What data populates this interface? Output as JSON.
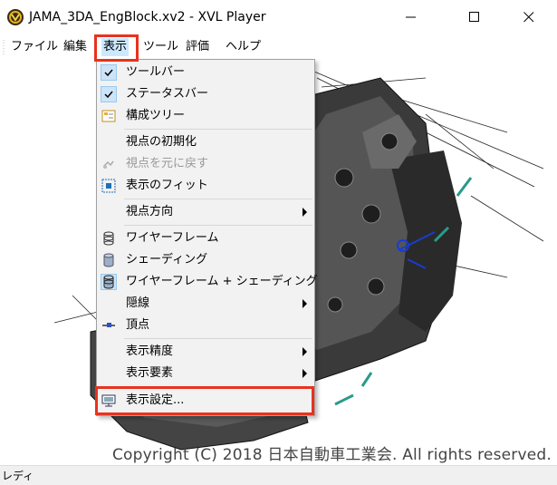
{
  "window": {
    "title": "JAMA_3DA_EngBlock.xv2 - XVL Player",
    "minimize_glyph": "—",
    "maximize_glyph": "☐",
    "close_glyph": "✕"
  },
  "menubar": {
    "items": [
      "ファイル",
      "編集",
      "表示",
      "ツール",
      "評価",
      "ヘルプ"
    ]
  },
  "dropdown": {
    "items": [
      {
        "label": "ツールバー",
        "checked": true
      },
      {
        "label": "ステータスバー",
        "checked": true
      },
      {
        "label": "構成ツリー",
        "icon": "tree-icon"
      },
      {
        "label": "視点の初期化"
      },
      {
        "label": "視点を元に戻す",
        "disabled": true,
        "icon": "undo-view-icon"
      },
      {
        "label": "表示のフィット",
        "icon": "fit-icon"
      },
      {
        "label": "視点方向",
        "submenu": true
      },
      {
        "label": "ワイヤーフレーム",
        "icon": "wireframe-icon"
      },
      {
        "label": "シェーディング",
        "icon": "shading-icon"
      },
      {
        "label": "ワイヤーフレーム + シェーディング",
        "icon": "wireframe-shading-icon"
      },
      {
        "label": "隠線",
        "submenu": true
      },
      {
        "label": "頂点",
        "icon": "vertex-icon"
      },
      {
        "label": "表示精度",
        "submenu": true
      },
      {
        "label": "表示要素",
        "submenu": true
      },
      {
        "label": "表示設定...",
        "icon": "display-settings-icon"
      }
    ]
  },
  "canvas": {
    "copyright": "Copyright (C) 2018 日本自動車工業会. All rights reserved."
  },
  "status": {
    "text": "レディ"
  },
  "colors": {
    "highlight": "#e8321e",
    "menu_bg": "#f2f2f2",
    "accent": "#1f6fb5"
  }
}
